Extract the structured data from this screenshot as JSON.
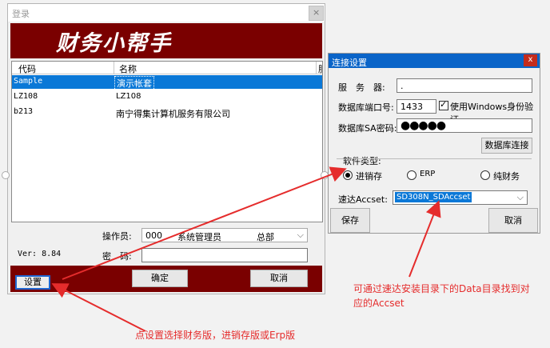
{
  "login": {
    "title": "登录",
    "close_glyph": "×",
    "brand": "财务小帮手",
    "columns": [
      "代码",
      "名称",
      "服"
    ],
    "rows": [
      {
        "code": "Sample",
        "name": "演示帐套",
        "selected": true
      },
      {
        "code": "LZ108",
        "name": "LZ108",
        "selected": false
      },
      {
        "code": "b213",
        "name": "南宁得集计算机服务有限公司",
        "selected": false
      }
    ],
    "operator_label": "操作员:",
    "operator": {
      "code": "000",
      "name": "系统管理员",
      "dept": "总部"
    },
    "version": "Ver: 8.84",
    "password_label": "密　码:",
    "settings_button": "设置",
    "ok_button": "确定",
    "cancel_button": "取消"
  },
  "conn": {
    "title": "连接设置",
    "close_glyph": "x",
    "server_label": "服　务　器:",
    "server_value": ".",
    "port_label": "数据库端口号:",
    "port_value": "1433",
    "windows_auth_label": "使用Windows身份验证",
    "windows_auth_checked": true,
    "sa_label": "数据库SA密码:",
    "sa_value": "●●●●●",
    "db_connect_button": "数据库连接",
    "software_type_label": "软件类型:",
    "options": [
      {
        "label": "进销存",
        "selected": true
      },
      {
        "label": "ERP",
        "selected": false
      },
      {
        "label": "纯财务",
        "selected": false
      }
    ],
    "accset_label": "速达Accset:",
    "accset_value": "SD308N_SDAccset",
    "save_button": "保存",
    "cancel_button": "取消"
  },
  "annotations": {
    "note_accset_1": "可通过速达安装目录下的Data目录找到对",
    "note_accset_2": "应的Accset",
    "note_settings": "点设置选择财务版，进销存版或Erp版"
  },
  "colors": {
    "banner": "#7a0000",
    "selection": "#0a78d7",
    "annotation": "#e52c2c"
  }
}
